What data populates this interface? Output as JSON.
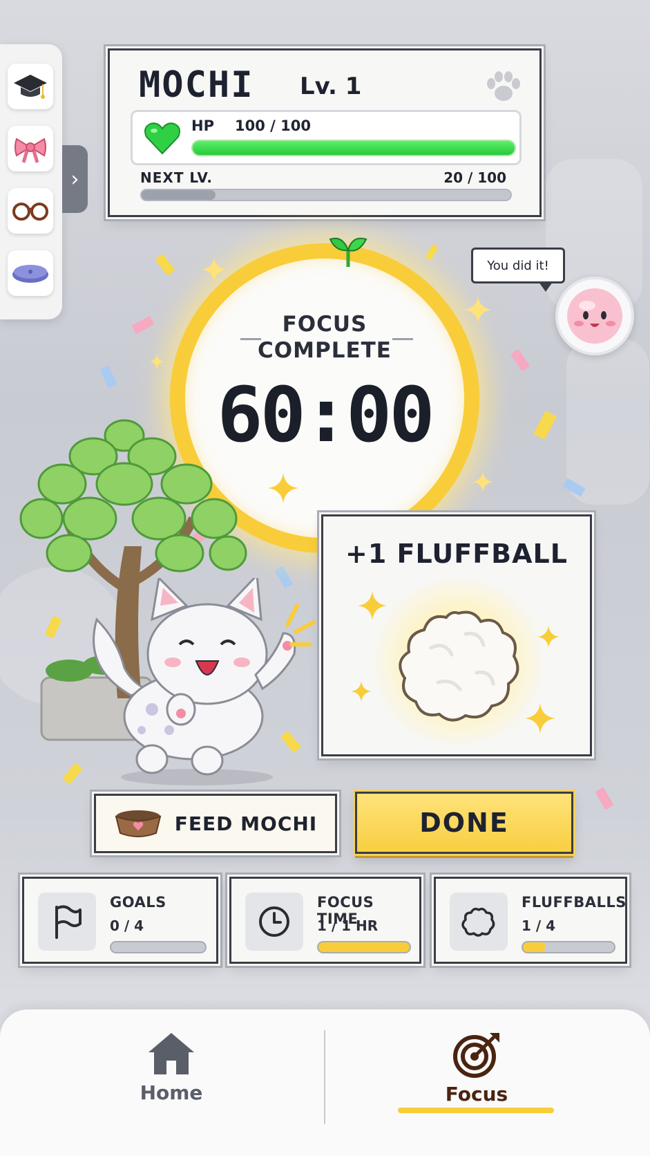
{
  "pet": {
    "name": "MOCHI",
    "level": "Lv. 1",
    "hp_label": "HP",
    "hp_value": "100 / 100",
    "hp_fraction": 1.0,
    "next_label": "NEXT LV.",
    "next_value": "20 / 100",
    "xp_fraction": 0.2
  },
  "dock": {
    "items": [
      "graduation-cap-icon",
      "bow-icon",
      "glasses-icon",
      "cushion-icon"
    ],
    "toggle_icon": "chevron-right-icon"
  },
  "timer": {
    "title": "FOCUS COMPLETE",
    "value": "60:00",
    "progress": 1.0
  },
  "buddy": {
    "speech": "You did it!"
  },
  "reward": {
    "title": "+1 FLUFFBALL"
  },
  "actions": {
    "feed_label": "FEED MOCHI",
    "done_label": "DONE"
  },
  "stats": [
    {
      "label": "GOALS",
      "value": "0 / 4",
      "fraction": 0.0,
      "icon": "flag-icon"
    },
    {
      "label": "FOCUS TIME",
      "value": "1 / 1 HR",
      "fraction": 1.0,
      "icon": "clock-icon"
    },
    {
      "label": "FLUFFBALLS",
      "value": "1 / 4",
      "fraction": 0.25,
      "icon": "cloud-icon"
    }
  ],
  "nav": {
    "home_label": "Home",
    "focus_label": "Focus",
    "active": "Focus"
  },
  "colors": {
    "accent": "#f8cd39",
    "hp_green": "#2fd044",
    "text_dark": "#1e2230",
    "focus_label": "#4a2410",
    "home_label": "#5a5e68"
  }
}
